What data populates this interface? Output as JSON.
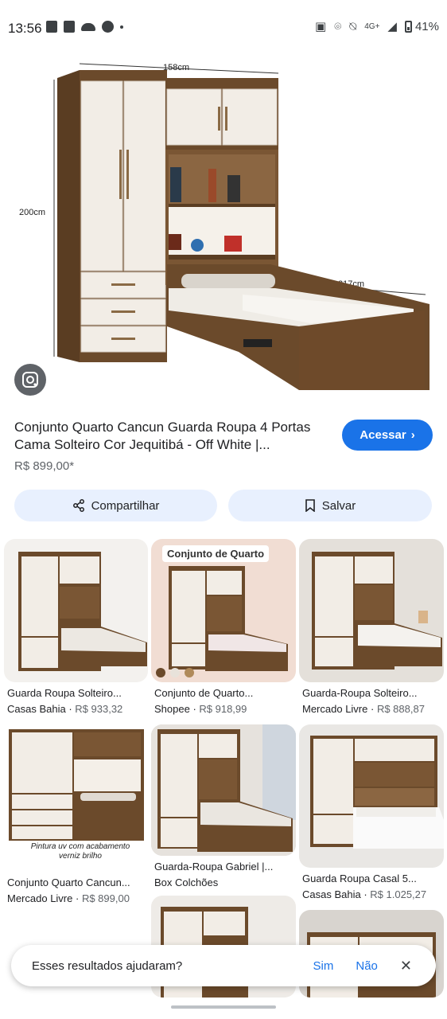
{
  "status": {
    "time": "13:56",
    "network": "4G+",
    "battery": "41%"
  },
  "hero": {
    "dim_width": "158cm",
    "dim_height": "200cm",
    "dim_depth": "217cm"
  },
  "product": {
    "title_line1": "Conjunto Quarto Cancun Guarda Roupa 4 Portas",
    "title_line2": "Cama Solteiro Cor Jequitibá - Off White |...",
    "price": "R$ 899,00*",
    "visit_label": "Acessar",
    "share_label": "Compartilhar",
    "save_label": "Salvar"
  },
  "results": [
    {
      "title": "Guarda Roupa Solteiro...",
      "source": "Casas Bahia",
      "price": "R$ 933,32"
    },
    {
      "title": "Conjunto de Quarto...",
      "source": "Shopee",
      "price": "R$ 918,99",
      "overlay": "Conjunto de Quarto"
    },
    {
      "title": "Guarda-Roupa Solteiro...",
      "source": "Mercado Livre",
      "price": "R$ 888,87"
    },
    {
      "title": "Conjunto Quarto Cancun...",
      "source": "Mercado Livre",
      "price": "R$ 899,00",
      "overlay": "Pintura uv com acabamento verniz brilho"
    },
    {
      "title": "Guarda-Roupa Gabriel |...",
      "source": "Box Colchões",
      "price": ""
    },
    {
      "title": "Guarda Roupa Casal 5...",
      "source": "Casas Bahia",
      "price": "R$ 1.025,27"
    }
  ],
  "feedback": {
    "question": "Esses resultados ajudaram?",
    "yes": "Sim",
    "no": "Não"
  },
  "colors": {
    "accent": "#1a73e8",
    "chip_bg": "#e8f0fe",
    "wood": "#6b4a2b",
    "white_panel": "#f2ede6"
  }
}
